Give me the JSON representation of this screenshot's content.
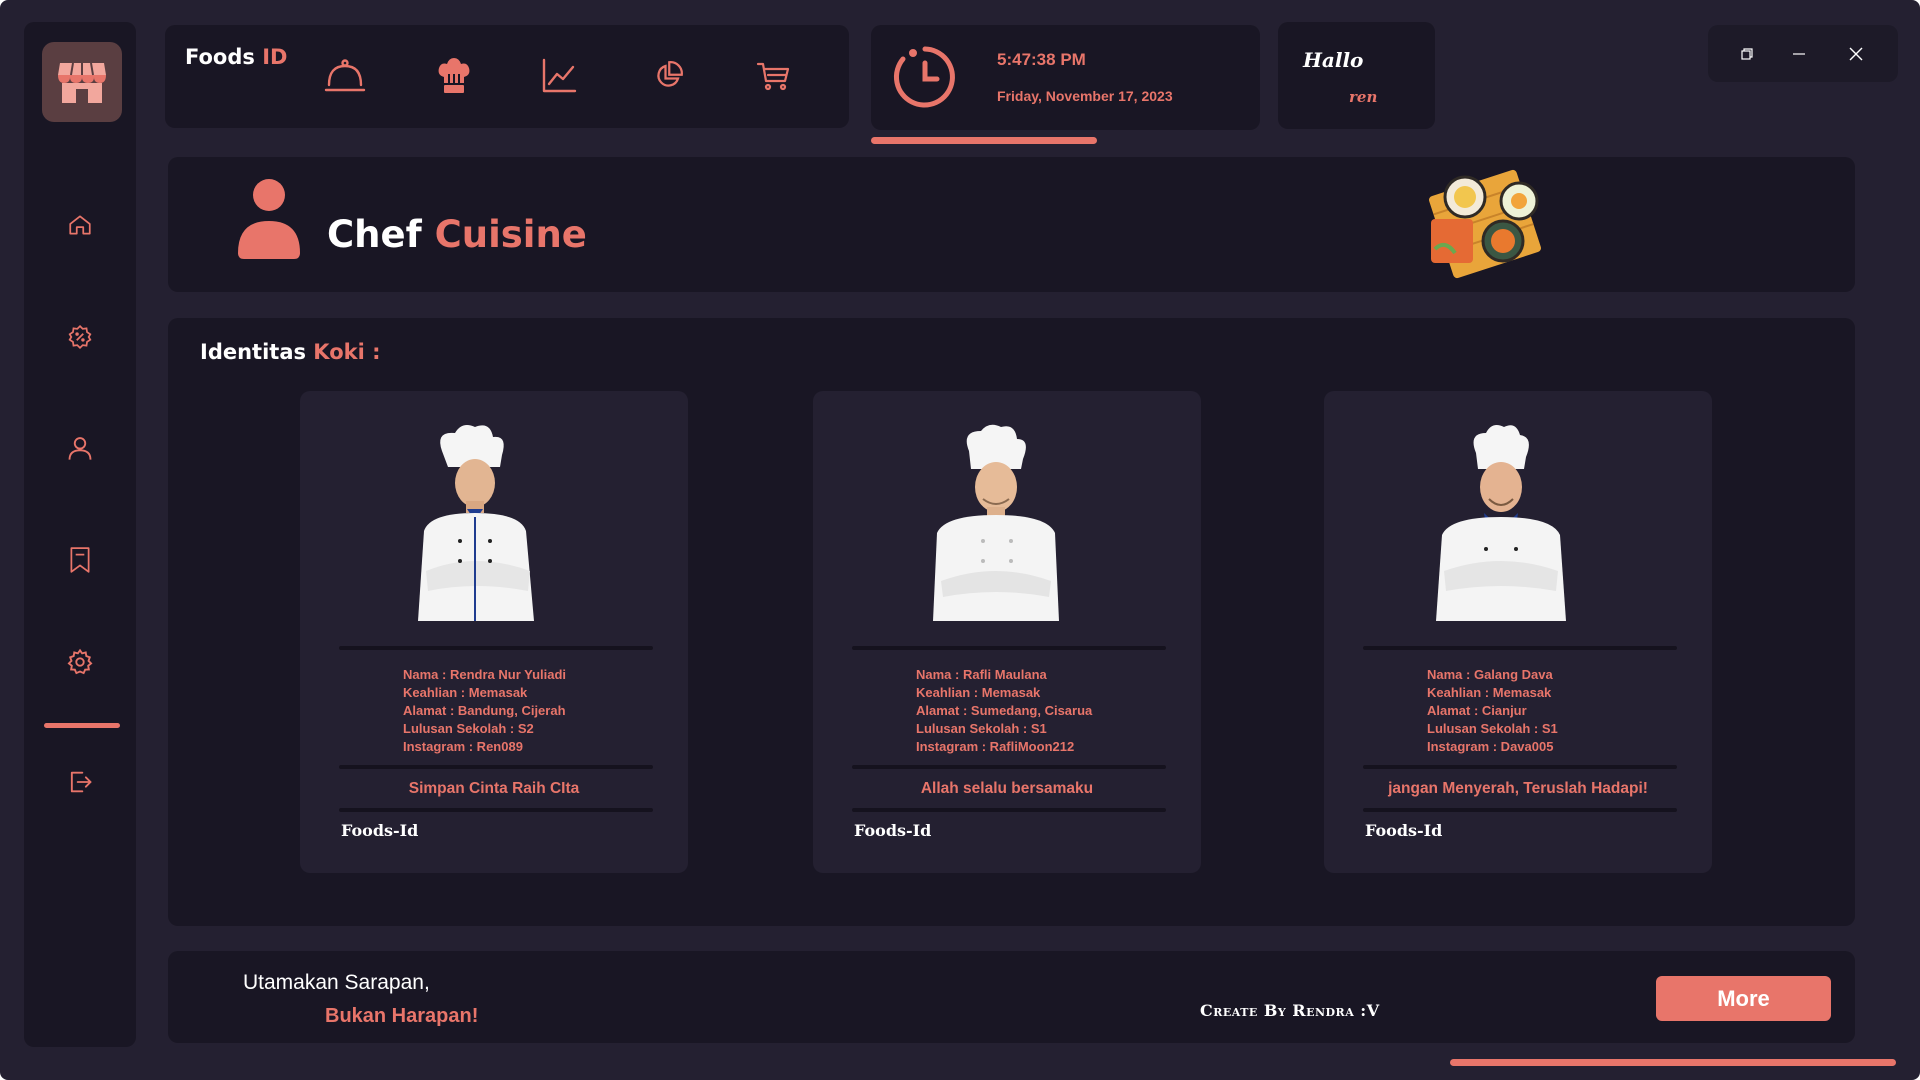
{
  "app": {
    "brand_main": "Foods",
    "brand_accent": "ID",
    "accent_color": "#e8756a",
    "background_color": "#242031",
    "panel_color": "#191624"
  },
  "sidebar": {
    "logo_icon": "store-icon",
    "items": [
      {
        "icon": "home-icon"
      },
      {
        "icon": "discount-badge-icon"
      },
      {
        "icon": "user-icon"
      },
      {
        "icon": "bookmark-icon"
      },
      {
        "icon": "settings-gear-icon"
      },
      {
        "icon": "logout-icon"
      }
    ],
    "active_item": "settings-gear-icon"
  },
  "topnav": {
    "icons": [
      "cloche-icon",
      "chef-hat-icon",
      "line-chart-icon",
      "pie-chart-icon",
      "cart-icon"
    ]
  },
  "clock": {
    "time": "5:47:38 PM",
    "date": "Friday, November 17, 2023"
  },
  "greeting": {
    "line1": "Hallo",
    "line2": "ren"
  },
  "header": {
    "title_main": "Chef",
    "title_accent": "Cuisine"
  },
  "section": {
    "title_main": "Identitas",
    "title_accent": "Koki :"
  },
  "chefs": [
    {
      "nama": "Nama : Rendra Nur Yuliadi",
      "keahlian": "Keahlian : Memasak",
      "alamat": "Alamat : Bandung, Cijerah",
      "lulusan": "Lulusan Sekolah : S2",
      "instagram": "Instagram : Ren089",
      "quote": "Simpan Cinta Raih CIta",
      "footer": "Foods-Id"
    },
    {
      "nama": "Nama : Rafli Maulana",
      "keahlian": "Keahlian : Memasak",
      "alamat": "Alamat : Sumedang, Cisarua",
      "lulusan": "Lulusan Sekolah : S1",
      "instagram": "Instagram : RafliMoon212",
      "quote": "Allah selalu bersamaku",
      "footer": "Foods-Id"
    },
    {
      "nama": "Nama : Galang Dava",
      "keahlian": "Keahlian : Memasak",
      "alamat": "Alamat : Cianjur",
      "lulusan": "Lulusan Sekolah : S1",
      "instagram": "Instagram : Dava005",
      "quote": "jangan Menyerah, Teruslah Hadapi!",
      "footer": "Foods-Id"
    }
  ],
  "footer": {
    "slogan_line1": "Utamakan Sarapan,",
    "slogan_line2": "Bukan Harapan!",
    "credit": "Create By Rendra :V",
    "more_label": "More"
  }
}
